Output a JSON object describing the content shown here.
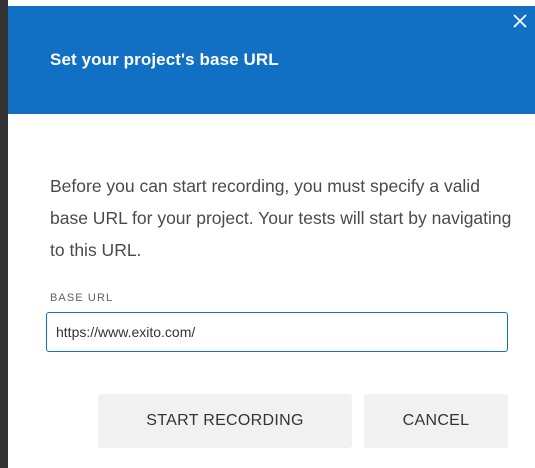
{
  "dialog": {
    "title": "Set your project's base URL",
    "description": "Before you can start recording, you must specify a valid base URL for your project. Your tests will start by navigating to this URL.",
    "field": {
      "label": "BASE URL",
      "value": "https://www.exito.com/"
    },
    "buttons": {
      "start": "START RECORDING",
      "cancel": "CANCEL"
    },
    "close_icon": "close-icon"
  },
  "colors": {
    "header": "#1170c3",
    "input_border": "#1170c3",
    "button_bg": "#f1f1f1",
    "text": "#4a4a4a"
  }
}
